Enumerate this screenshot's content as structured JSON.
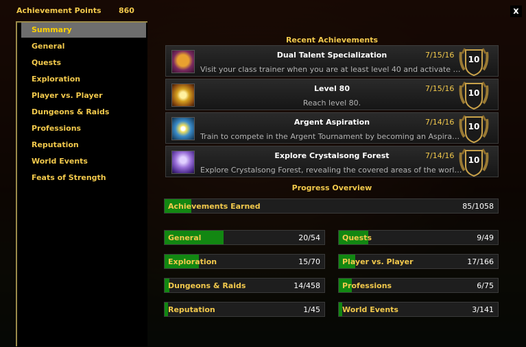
{
  "header": {
    "title": "Achievement Points",
    "points": "860",
    "close": "x"
  },
  "sidebar": {
    "items": [
      {
        "label": "Summary",
        "selected": true
      },
      {
        "label": "General"
      },
      {
        "label": "Quests"
      },
      {
        "label": "Exploration"
      },
      {
        "label": "Player vs. Player"
      },
      {
        "label": "Dungeons & Raids"
      },
      {
        "label": "Professions"
      },
      {
        "label": "Reputation"
      },
      {
        "label": "World Events"
      },
      {
        "label": "Feats of Strength"
      }
    ]
  },
  "recent": {
    "title": "Recent Achievements",
    "items": [
      {
        "name": "Dual Talent Specialization",
        "desc": "Visit your class trainer when you are at least level 40 and activate your Dual Talent Specialization.",
        "date": "7/15/16",
        "points": "10",
        "icon": "dual-talent-icon"
      },
      {
        "name": "Level 80",
        "desc": "Reach level 80.",
        "date": "7/15/16",
        "points": "10",
        "icon": "level-80-icon"
      },
      {
        "name": "Argent Aspiration",
        "desc": "Train to compete in the Argent Tournament by becoming an Aspirant for your faction.",
        "date": "7/14/16",
        "points": "10",
        "icon": "argent-aspiration-icon"
      },
      {
        "name": "Explore Crystalsong Forest",
        "desc": "Explore Crystalsong Forest, revealing the covered areas of the world map.",
        "date": "7/14/16",
        "points": "10",
        "icon": "crystalsong-forest-icon"
      }
    ]
  },
  "progress": {
    "title": "Progress Overview",
    "total": {
      "label": "Achievements Earned",
      "count": "85/1058",
      "fraction": 0.0803
    },
    "categories": [
      {
        "label": "General",
        "count": "20/54",
        "fraction": 0.37
      },
      {
        "label": "Quests",
        "count": "9/49",
        "fraction": 0.184
      },
      {
        "label": "Exploration",
        "count": "15/70",
        "fraction": 0.214
      },
      {
        "label": "Player vs. Player",
        "count": "17/166",
        "fraction": 0.102
      },
      {
        "label": "Dungeons & Raids",
        "count": "14/458",
        "fraction": 0.031
      },
      {
        "label": "Professions",
        "count": "6/75",
        "fraction": 0.08
      },
      {
        "label": "Reputation",
        "count": "1/45",
        "fraction": 0.022
      },
      {
        "label": "World Events",
        "count": "3/141",
        "fraction": 0.021
      }
    ]
  },
  "colors": {
    "accent": "#f2c94c",
    "bar_fill": "#128712",
    "selected_bg": "#6e6e6e"
  }
}
